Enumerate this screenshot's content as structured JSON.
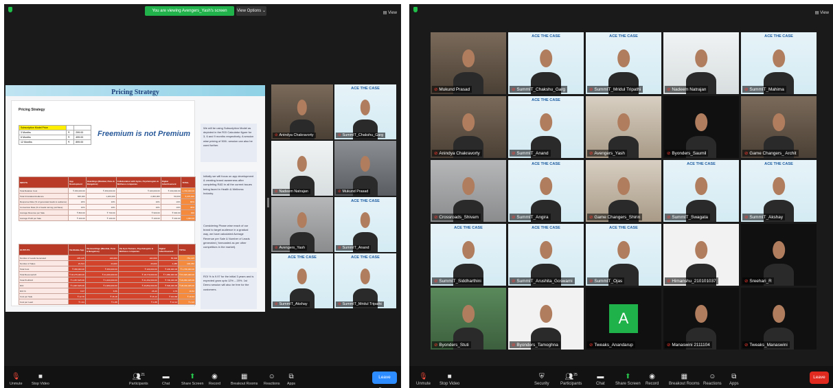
{
  "left_window": {
    "banner": "You are viewing Avengers_Yash's screen",
    "view_options": "View Options ⌄",
    "view_label": "View",
    "shared_screen": {
      "title": "Pricing Strategy",
      "section_label": "Pricing Strategy",
      "headline": "Freemium is not Premium",
      "subscription_rows": [
        [
          "Subscription Model Price",
          "",
          ""
        ],
        [
          "3 Months",
          "₹",
          "299.00"
        ],
        [
          "6 Months",
          "₹",
          "499.00"
        ],
        [
          "12 Months",
          "₹",
          "899.00"
        ]
      ],
      "inputs_header": [
        "INPUTS",
        "App Development",
        "Hoardings (Mumbai, Pune & Bangalore)",
        "Collaboration with Gyms, Psychologists & Wellness companies",
        "Digital Advertisement",
        "TOTAL"
      ],
      "inputs_rows": [
        [
          "Total Relation Cost",
          "₹ 450,000.00",
          "₹ 450,000.00",
          "₹ 100,000.00",
          "₹ 200,000.00",
          "1,700,000.00"
        ],
        [
          "Total Circulation/Audience",
          "825,000",
          "1,200,000",
          "2,000,000",
          "50,000",
          "5,475,000"
        ],
        [
          "Response Rate (% of generated leads to audience)",
          "20%",
          "10%",
          "10%",
          "10%",
          "80%"
        ],
        [
          "Conversion Rate (% of leads turning purchase)",
          "10%",
          "10%",
          "10%",
          "10%",
          "36%"
        ],
        [
          "Average Revenue per Sale",
          "₹ 800.00",
          "₹ 700.00",
          "₹ 900.00",
          "₹ 600.00",
          "900"
        ],
        [
          "Average Profit per Sale",
          "₹ 160.00",
          "₹ 100.00",
          "₹ 100.00",
          "₹ 240.00",
          "1,000.00"
        ]
      ],
      "outputs_header": [
        "OUTPUTS",
        "Via Mobile App",
        "Via Hoardings (Mumbai, Pune & Bangalore)",
        "Via Gym Trainers, Psychologists & Wellness companies",
        "Digital Advertisement",
        "TOTAL"
      ],
      "outputs_rows": [
        [
          "Number of Leads Generated",
          "235,125",
          "240,000",
          "222,000",
          "55,000",
          "752,125"
        ],
        [
          "Number of Sales",
          "23,513",
          "24,000",
          "20,000",
          "4,485",
          "100,350"
        ],
        [
          "Total Cost",
          "₹ 450,000.00",
          "₹ 450,000.00",
          "₹ 100,000.00",
          "₹ 200,000.00",
          "₹ 1,700,000.00"
        ],
        [
          "Total Revenue/Lift",
          "₹ 18,275,000.00",
          "₹ 21,000,000.00",
          "₹ 18,770,000.00",
          "₹ 7,880,000.00",
          "₹ 67,925,000.00"
        ],
        [
          "Total Profit/Lift",
          "₹ 4,357,625.00",
          "₹ 3,400,000.00",
          "₹ 21,252,000.00",
          "₹ 700,400.00",
          "₹ 29,960,025.00"
        ],
        [
          "ROI",
          "₹ 4,907,625.00",
          "₹ 2,950,000.00",
          "₹ 20,852,000.00",
          "₹ 500,400.00",
          "₹ 28,160,025.00"
        ],
        [
          "ROI %",
          "9.37",
          "6.56",
          "26.43",
          "0.76",
          "16.52"
        ],
        [
          "Cost per Sale",
          "₹ 12.76",
          "₹ 15.18",
          "₹ 15.13",
          "₹ 104.68",
          "₹ 16.94"
        ],
        [
          "Cost per Lead",
          "₹ 1.91",
          "₹ 1.88",
          "₹ 1.88",
          "₹ 12.12",
          "₹ 2.26"
        ]
      ],
      "notes": [
        "We will be using Subscription Model as depicted in the ROI Calculator figure for 3, 6 and 9 months respectively. A session wise pricing of 500/- session can also be used further.",
        "Initially we will focus on app development & creating brand awareness after completing R&D in all the current issues being faced in Health & Wellness Industry.",
        "Considering Phase wise reach of our brand to target audience in a gradual way, we have calculated Average Revenue per Sale & Number of Leads generated ( forecasted as per other competitors in the market).",
        "ROI % is 9.97 for the initial 3 years and is expected grow upto 12% – 20%. 1st Demo session will also be free for the customers."
      ]
    },
    "tiles": [
      {
        "name": "Anindya Chakravorty",
        "logo": ""
      },
      {
        "name": "SummIT_Chakshu_Garg",
        "logo": "ACE THE CASE"
      },
      {
        "name": "Nadeem Natrajan",
        "logo": ""
      },
      {
        "name": "Mukund Prasad",
        "logo": ""
      },
      {
        "name": "Avengers_Yash",
        "logo": ""
      },
      {
        "name": "SummIT_Anand",
        "logo": "ACE THE CASE"
      },
      {
        "name": "SummIT_Akshay",
        "logo": "ACE THE CASE"
      },
      {
        "name": "SummIT_Mridul Tripathi",
        "logo": "ACE THE CASE"
      }
    ],
    "toolbar": {
      "unmute": "Unmute",
      "stop_video": "Stop Video",
      "participants": "Participants",
      "participants_count": "21",
      "chat": "Chat",
      "share_screen": "Share Screen",
      "record": "Record",
      "breakout": "Breakout Rooms",
      "reactions": "Reactions",
      "apps": "Apps",
      "leave": "Leave Room"
    }
  },
  "right_window": {
    "view_label": "View",
    "tiles": [
      {
        "name": "Mukund Prasad",
        "logo": ""
      },
      {
        "name": "SummIT_Chakshu_Garg",
        "logo": "ACE THE CASE"
      },
      {
        "name": "SummIT_Mridul Tripathi",
        "logo": "ACE THE CASE"
      },
      {
        "name": "Nadeem Natrajan",
        "logo": ""
      },
      {
        "name": "SummIT_Mahima",
        "logo": "ACE THE CASE"
      },
      {
        "name": "Anindya Chakravorty",
        "logo": ""
      },
      {
        "name": "SummIT_Anand",
        "logo": "ACE THE CASE"
      },
      {
        "name": "Avengers_Yash",
        "logo": ""
      },
      {
        "name": "Byonders_Saumil",
        "logo": ""
      },
      {
        "name": "Game Changers_ Archit",
        "logo": ""
      },
      {
        "name": "Crossroads_Shivam",
        "logo": ""
      },
      {
        "name": "SummIT_Angira",
        "logo": "ACE THE CASE"
      },
      {
        "name": "Game Changers_Shirin",
        "logo": ""
      },
      {
        "name": "SummIT_Swagata",
        "logo": "ACE THE CASE"
      },
      {
        "name": "SummIT_Akshay",
        "logo": "ACE THE CASE"
      },
      {
        "name": "SummIT_Siddharthini",
        "logo": "ACE THE CASE"
      },
      {
        "name": "SummIT_Arushita_Goswami",
        "logo": "ACE THE CASE"
      },
      {
        "name": "SummIT_Ojas",
        "logo": "ACE THE CASE"
      },
      {
        "name": "Himanshu_210101037",
        "logo": ""
      },
      {
        "name": "Sreehari_R",
        "logo": ""
      },
      {
        "name": "Byonders_Stuti",
        "logo": ""
      },
      {
        "name": "Byonders_Tamoghna",
        "logo": ""
      },
      {
        "name": "Tweaks_Anandarup",
        "logo": "",
        "letter": "A"
      },
      {
        "name": "Manaswini 2111104",
        "logo": ""
      },
      {
        "name": "Tweaks_Manaswini",
        "logo": ""
      }
    ],
    "toolbar": {
      "unmute": "Unmute",
      "stop_video": "Stop Video",
      "security": "Security",
      "participants": "Participants",
      "participants_count": "25",
      "chat": "Chat",
      "share_screen": "Share Screen",
      "record": "Record",
      "breakout": "Breakout Rooms",
      "reactions": "Reactions",
      "apps": "Apps",
      "leave": "Leave"
    }
  }
}
